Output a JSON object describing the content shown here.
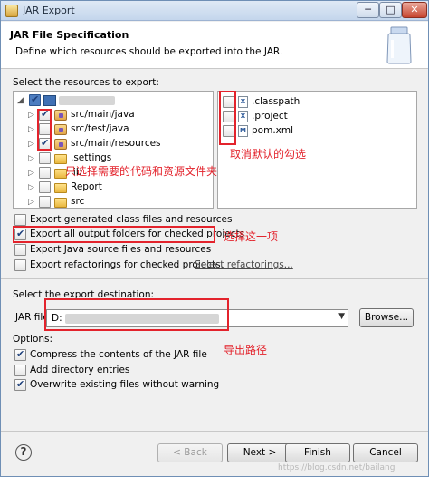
{
  "window": {
    "title": "JAR Export",
    "min": "─",
    "max": "□",
    "close": "✕"
  },
  "header": {
    "title": "JAR File Specification",
    "description": "Define which resources should be exported into the JAR."
  },
  "resources": {
    "label": "Select the resources to export:",
    "tree": [
      {
        "label": "",
        "checked": true
      },
      {
        "label": "src/main/java",
        "checked": true
      },
      {
        "label": "src/test/java",
        "checked": false
      },
      {
        "label": "src/main/resources",
        "checked": true
      },
      {
        "label": ".settings",
        "checked": false
      },
      {
        "label": "lib",
        "checked": false
      },
      {
        "label": "Report",
        "checked": false
      },
      {
        "label": "src",
        "checked": false
      }
    ],
    "files": [
      {
        "label": ".classpath",
        "icon": "X",
        "checked": false
      },
      {
        "label": ".project",
        "icon": "X",
        "checked": false
      },
      {
        "label": "pom.xml",
        "icon": "M",
        "checked": false
      }
    ]
  },
  "export_options": [
    {
      "label": "Export generated class files and resources",
      "checked": false
    },
    {
      "label": "Export all output folders for checked projects",
      "checked": true
    },
    {
      "label": "Export Java source files and resources",
      "checked": false
    },
    {
      "label": "Export refactorings for checked projects.",
      "checked": false
    }
  ],
  "select_refactorings": "Select refactorings...",
  "destination": {
    "label": "Select the export destination:",
    "jar_file_label": "JAR file:",
    "jar_file_value": "D:",
    "browse": "Browse..."
  },
  "options": {
    "label": "Options:",
    "items": [
      {
        "label": "Compress the contents of the JAR file",
        "checked": true
      },
      {
        "label": "Add directory entries",
        "checked": false
      },
      {
        "label": "Overwrite existing files without warning",
        "checked": true
      }
    ]
  },
  "annotations": {
    "uncheck_default": "取消默认的勾选",
    "select_needed": "只选择需要的代码和资源文件夹",
    "select_this": "选择这一项",
    "export_path": "导出路径"
  },
  "buttons": {
    "back": "< Back",
    "next": "Next >",
    "finish": "Finish",
    "cancel": "Cancel"
  },
  "watermark": "https://blog.csdn.net/bailang",
  "colors": {
    "annotation": "#e3232c",
    "link": "#4a4a4a"
  }
}
